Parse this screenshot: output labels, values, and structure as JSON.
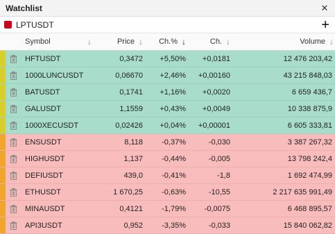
{
  "window": {
    "title": "Watchlist"
  },
  "list": {
    "name": "LPTUSDT",
    "swatch_color": "#d0021b",
    "add_icon": "plus-icon"
  },
  "columns": {
    "symbol": "Symbol",
    "price": "Price",
    "change_pct": "Ch.%",
    "change": "Ch.",
    "volume": "Volume"
  },
  "colors": {
    "positive_bg": "#a8dccb",
    "negative_bg": "#f9bcbc",
    "flag_yellow": "#d8d02a",
    "flag_orange": "#f0a52c"
  },
  "rows": [
    {
      "symbol": "HFTUSDT",
      "price": "0,3472",
      "change_pct": "+5,50%",
      "change": "+0,0181",
      "volume": "12 476 203,42",
      "trend": "up",
      "flag": "yellow"
    },
    {
      "symbol": "1000LUNCUSDT",
      "price": "0,06670",
      "change_pct": "+2,46%",
      "change": "+0,00160",
      "volume": "43 215 848,03",
      "trend": "up",
      "flag": "yellow"
    },
    {
      "symbol": "BATUSDT",
      "price": "0,1741",
      "change_pct": "+1,16%",
      "change": "+0,0020",
      "volume": "6 659 436,7",
      "trend": "up",
      "flag": "yellow"
    },
    {
      "symbol": "GALUSDT",
      "price": "1,1559",
      "change_pct": "+0,43%",
      "change": "+0,0049",
      "volume": "10 338 875,9",
      "trend": "up",
      "flag": "yellow"
    },
    {
      "symbol": "1000XECUSDT",
      "price": "0,02426",
      "change_pct": "+0,04%",
      "change": "+0,00001",
      "volume": "6 605 333,81",
      "trend": "up",
      "flag": "yellow"
    },
    {
      "symbol": "ENSUSDT",
      "price": "8,118",
      "change_pct": "-0,37%",
      "change": "-0,030",
      "volume": "3 387 267,32",
      "trend": "down",
      "flag": "orange"
    },
    {
      "symbol": "HIGHUSDT",
      "price": "1,137",
      "change_pct": "-0,44%",
      "change": "-0,005",
      "volume": "13 798 242,4",
      "trend": "down",
      "flag": "orange"
    },
    {
      "symbol": "DEFIUSDT",
      "price": "439,0",
      "change_pct": "-0,41%",
      "change": "-1,8",
      "volume": "1 692 474,99",
      "trend": "down",
      "flag": "orange"
    },
    {
      "symbol": "ETHUSDT",
      "price": "1 670,25",
      "change_pct": "-0,63%",
      "change": "-10,55",
      "volume": "2 217 635 991,49",
      "trend": "down",
      "flag": "orange"
    },
    {
      "symbol": "MINAUSDT",
      "price": "0,4121",
      "change_pct": "-1,79%",
      "change": "-0,0075",
      "volume": "6 468 895,57",
      "trend": "down",
      "flag": "orange"
    },
    {
      "symbol": "API3USDT",
      "price": "0,952",
      "change_pct": "-3,35%",
      "change": "-0,033",
      "volume": "15 840 062,82",
      "trend": "down",
      "flag": "orange"
    }
  ]
}
